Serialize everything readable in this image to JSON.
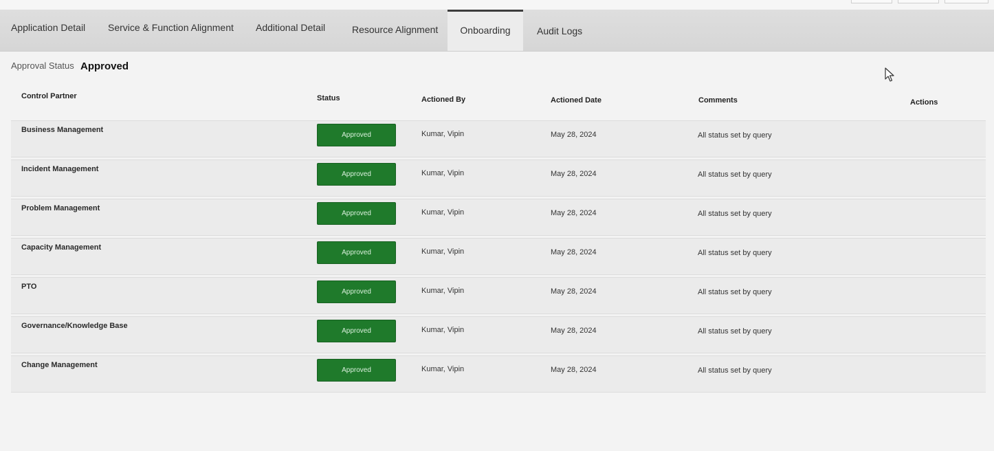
{
  "tabs": [
    {
      "label": "Application Detail"
    },
    {
      "label": "Service & Function Alignment"
    },
    {
      "label": "Additional Detail"
    },
    {
      "label": "Resource Alignment"
    },
    {
      "label": "Onboarding"
    },
    {
      "label": "Audit Logs"
    }
  ],
  "active_tab": "Onboarding",
  "approval": {
    "label": "Approval Status",
    "value": "Approved"
  },
  "table": {
    "headers": {
      "control_partner": "Control Partner",
      "status": "Status",
      "actioned_by": "Actioned By",
      "actioned_date": "Actioned Date",
      "comments": "Comments",
      "actions": "Actions"
    },
    "rows": [
      {
        "control_partner": "Business Management",
        "status": "Approved",
        "actioned_by": "Kumar, Vipin",
        "actioned_date": "May 28, 2024",
        "comments": "All status set by query"
      },
      {
        "control_partner": "Incident Management",
        "status": "Approved",
        "actioned_by": "Kumar, Vipin",
        "actioned_date": "May 28, 2024",
        "comments": "All status set by query"
      },
      {
        "control_partner": "Problem Management",
        "status": "Approved",
        "actioned_by": "Kumar, Vipin",
        "actioned_date": "May 28, 2024",
        "comments": "All status set by query"
      },
      {
        "control_partner": "Capacity Management",
        "status": "Approved",
        "actioned_by": "Kumar, Vipin",
        "actioned_date": "May 28, 2024",
        "comments": "All status set by query"
      },
      {
        "control_partner": "PTO",
        "status": "Approved",
        "actioned_by": "Kumar, Vipin",
        "actioned_date": "May 28, 2024",
        "comments": "All status set by query"
      },
      {
        "control_partner": "Governance/Knowledge Base",
        "status": "Approved",
        "actioned_by": "Kumar, Vipin",
        "actioned_date": "May 28, 2024",
        "comments": "All status set by query"
      },
      {
        "control_partner": "Change Management",
        "status": "Approved",
        "actioned_by": "Kumar, Vipin",
        "actioned_date": "May 28, 2024",
        "comments": "All status set by query"
      }
    ]
  },
  "colors": {
    "approved_button": "#1f7a2b",
    "active_tab_indicator": "#3c3c3c"
  },
  "icons": {
    "cursor": "mouse-pointer-icon"
  }
}
